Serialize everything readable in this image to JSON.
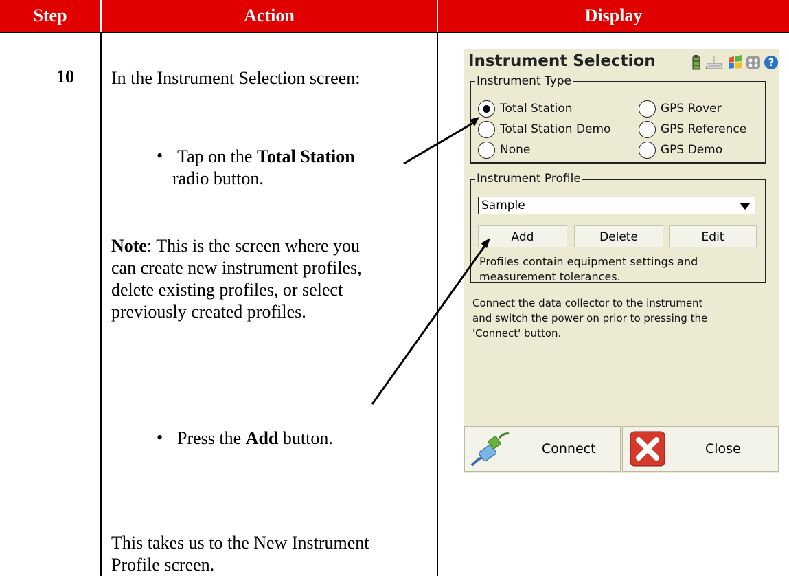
{
  "table": {
    "headers": [
      "Step",
      "Action",
      "Display"
    ],
    "step": "10",
    "action": {
      "intro": "In the Instrument Selection screen:",
      "bullet1_pre": "Tap on the ",
      "bullet1_bold": "Total Station",
      "bullet1_post": " radio button.",
      "note_bold": "Note",
      "note_text_line1": ":  This is the screen where you",
      "note_text_line2": "can create new instrument profiles,",
      "note_text_line3": "delete existing profiles, or select",
      "note_text_line4": "previously created profiles.",
      "bullet2_pre": "Press the ",
      "bullet2_bold": "Add",
      "bullet2_post": " button.",
      "outro_line1": "This takes us to the New Instrument",
      "outro_line2": "Profile screen."
    },
    "bullet_char": "•",
    "colors": {
      "header_bg": "#e00000",
      "header_text": "#ffffff"
    }
  },
  "screen": {
    "title": "Instrument Selection",
    "instrument_type_label": "Instrument Type",
    "radios": [
      {
        "label": "Total Station",
        "selected": true
      },
      {
        "label": "GPS Rover",
        "selected": false
      },
      {
        "label": "Total Station Demo",
        "selected": false
      },
      {
        "label": "GPS Reference",
        "selected": false
      },
      {
        "label": "None",
        "selected": false
      },
      {
        "label": "GPS Demo",
        "selected": false
      }
    ],
    "instrument_profile_label": "Instrument Profile",
    "profile_value": "Sample",
    "buttons": {
      "add": "Add",
      "delete": "Delete",
      "edit": "Edit"
    },
    "profile_help_line1": "Profiles contain equipment settings and",
    "profile_help_line2": "measurement tolerances.",
    "connect_help_line1": "Connect the data collector to the instrument",
    "connect_help_line2": "and switch the power on prior to pressing the",
    "connect_help_line3": "'Connect' button.",
    "connect_label": "Connect",
    "close_label": "Close",
    "tray_icons": [
      "battery-icon",
      "keyboard-icon",
      "windows-flag-icon",
      "apps-grid-icon",
      "help-icon"
    ]
  }
}
